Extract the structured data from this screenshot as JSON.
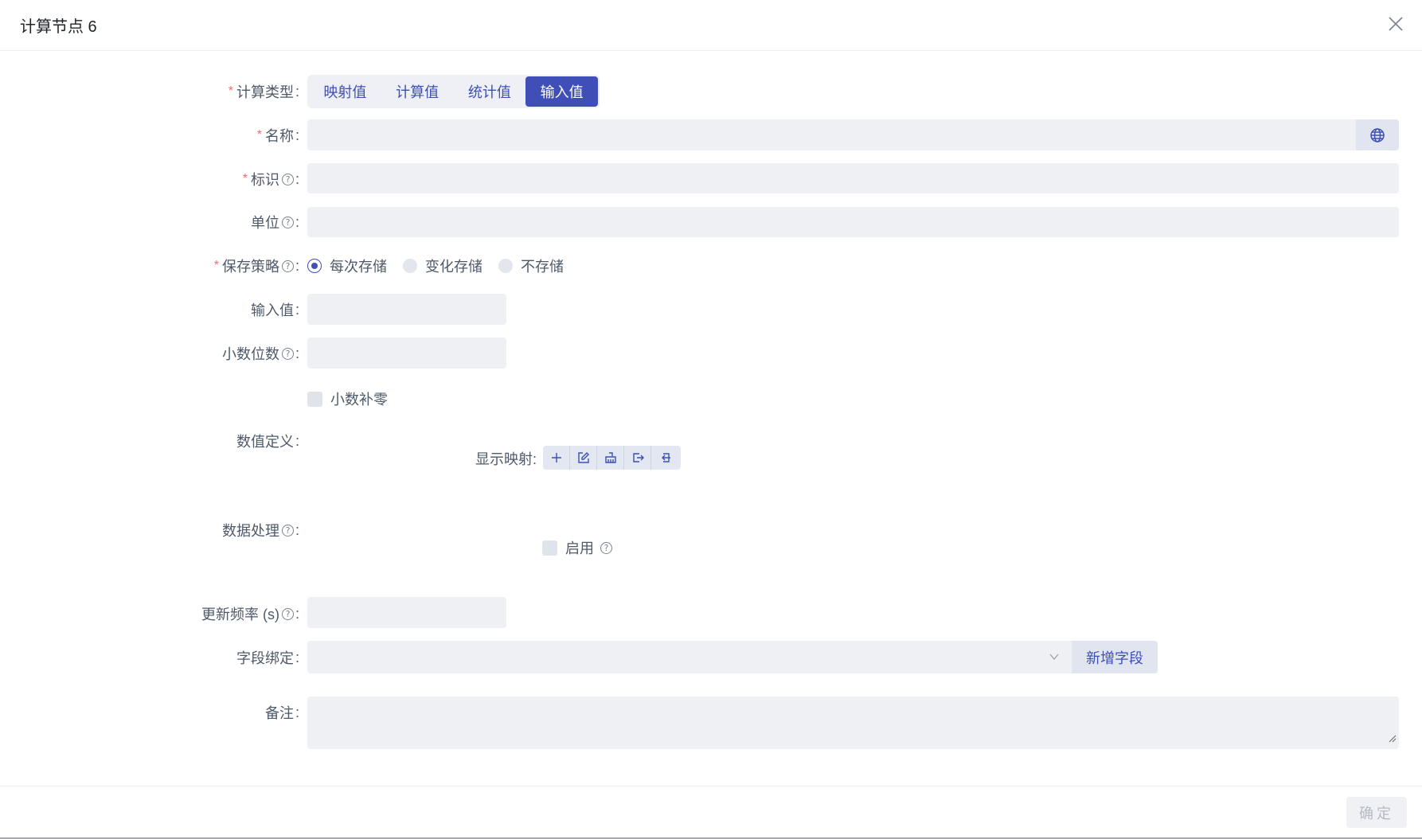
{
  "dialog": {
    "title": "计算节点 6"
  },
  "form": {
    "calc_type": {
      "label": "计算类型",
      "options": [
        "映射值",
        "计算值",
        "统计值",
        "输入值"
      ],
      "selected": "输入值"
    },
    "name": {
      "label": "名称",
      "value": ""
    },
    "identifier": {
      "label": "标识",
      "value": ""
    },
    "unit": {
      "label": "单位",
      "value": ""
    },
    "save_strategy": {
      "label": "保存策略",
      "options": [
        "每次存储",
        "变化存储",
        "不存储"
      ],
      "selected": "每次存储"
    },
    "input_value": {
      "label": "输入值",
      "value": ""
    },
    "decimals": {
      "label": "小数位数",
      "value": ""
    },
    "decimal_pad": {
      "label": "小数补零",
      "checked": false
    },
    "value_def": {
      "label": "数值定义",
      "display_mapping_label": "显示映射"
    },
    "data_processing": {
      "label": "数据处理",
      "enable_label": "启用",
      "checked": false
    },
    "update_rate": {
      "label": "更新频率 (s)",
      "value": ""
    },
    "field_binding": {
      "label": "字段绑定",
      "value": "",
      "add_button": "新增字段"
    },
    "remark": {
      "label": "备注",
      "value": ""
    }
  },
  "footer": {
    "confirm": "确定"
  },
  "colors": {
    "accent": "#3f4fb7",
    "required": "#f56c6c",
    "field_bg": "#eff0f3"
  }
}
